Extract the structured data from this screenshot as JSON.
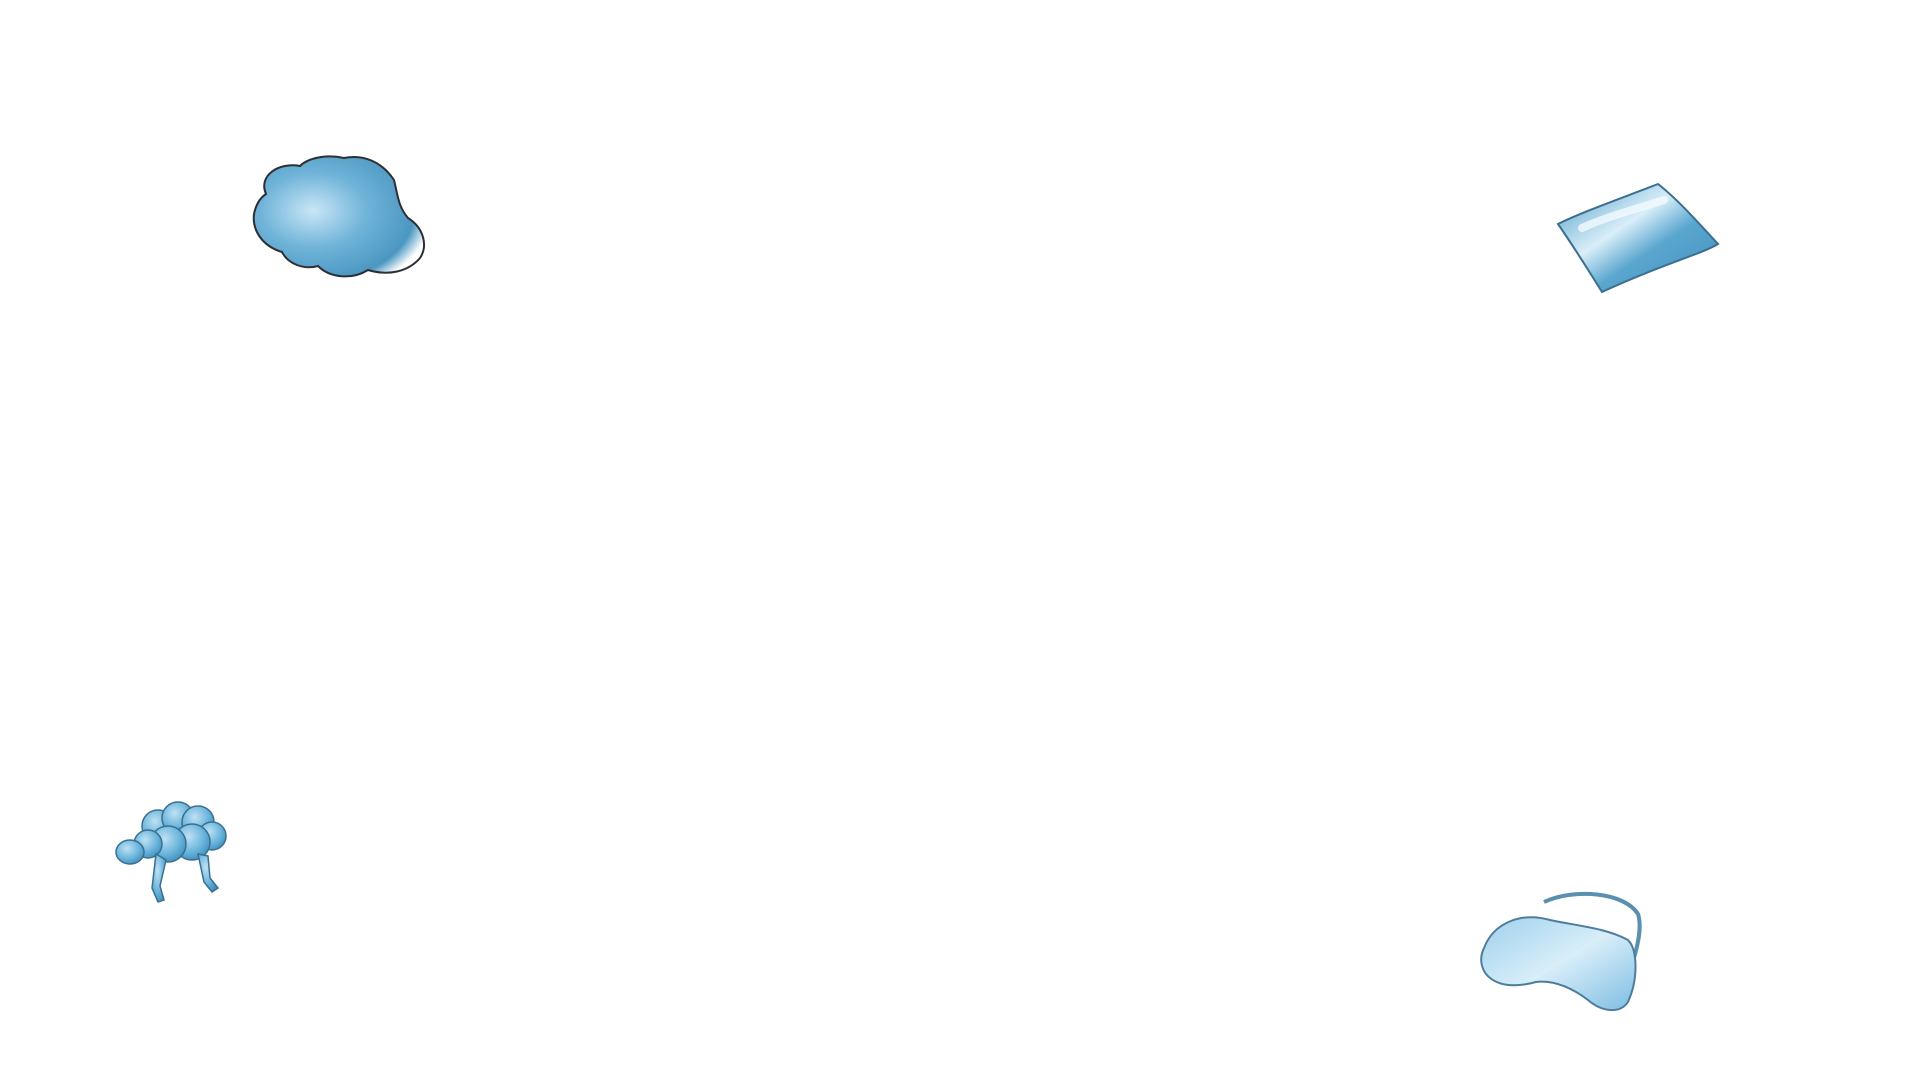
{
  "scene": {
    "background_color": "#ffffff",
    "objects": [
      {
        "name": "cloud",
        "icon": "cloud-icon",
        "color": "#5aa6cf"
      },
      {
        "name": "pillow",
        "icon": "pillow-icon",
        "color": "#5aa6cf"
      },
      {
        "name": "sheep",
        "icon": "sheep-icon",
        "color": "#6cb6dc"
      },
      {
        "name": "sleep-mask",
        "icon": "sleep-mask-icon",
        "color": "#8cc6e6"
      }
    ]
  }
}
